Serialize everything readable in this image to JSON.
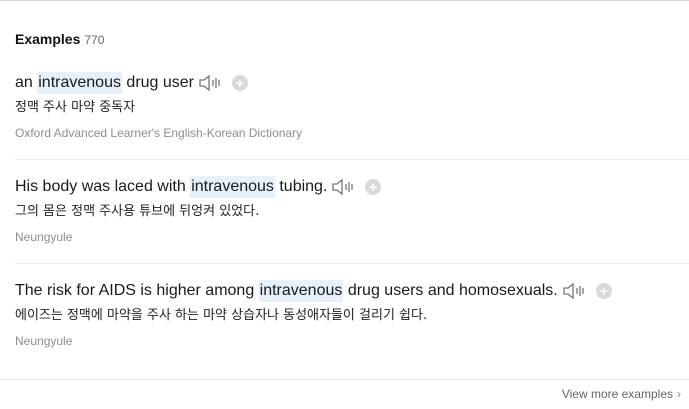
{
  "section": {
    "title": "Examples",
    "count": "770"
  },
  "examples": [
    {
      "before": "an ",
      "highlight": "intravenous",
      "after": " drug user",
      "translation": "정맥 주사 마약 중독자",
      "source": "Oxford Advanced Learner's English-Korean Dictionary"
    },
    {
      "before": "His body was laced with ",
      "highlight": "intravenous",
      "after": " tubing.",
      "translation": "그의 몸은 정맥 주사용 튜브에 뒤엉켜 있었다.",
      "source": "Neungyule"
    },
    {
      "before": "The risk for AIDS is higher among ",
      "highlight": "intravenous",
      "after": " drug users and homosexuals.",
      "translation": "에이즈는 정맥에 마약을 주사 하는 마약 상습자나 동성애자들이 걸리기 쉽다.",
      "source": "Neungyule"
    }
  ],
  "icons": {
    "speaker": "speaker-icon",
    "add": "add-icon",
    "chevron": "chevron-right-icon"
  },
  "add_glyph": "+",
  "footer": {
    "more_label": "View more examples",
    "chevron": "›"
  }
}
